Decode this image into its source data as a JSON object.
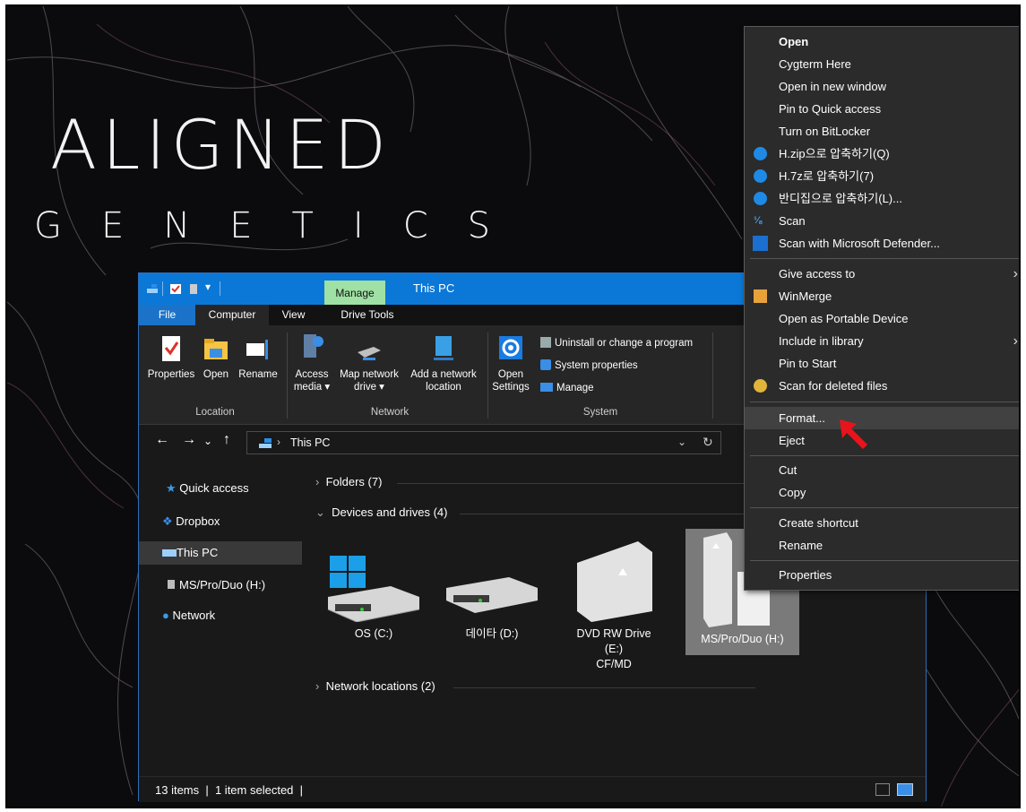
{
  "wallpaper": {
    "logo_main": "ALIGNED",
    "logo_sub": "GENETICS"
  },
  "explorer": {
    "title": "This PC",
    "context_tab": "Manage",
    "ribbon_tabs": [
      "File",
      "Computer",
      "View",
      "Drive Tools"
    ],
    "ribbon": {
      "location": {
        "group": "Location",
        "properties": "Properties",
        "open": "Open",
        "rename": "Rename"
      },
      "network": {
        "group": "Network",
        "access_media_1": "Access",
        "access_media_2": "media",
        "map_drive_1": "Map network",
        "map_drive_2": "drive",
        "add_location_1": "Add a network",
        "add_location_2": "location"
      },
      "system": {
        "group": "System",
        "open_settings_1": "Open",
        "open_settings_2": "Settings",
        "uninstall": "Uninstall or change a program",
        "system_properties": "System properties",
        "manage": "Manage"
      }
    },
    "address": {
      "path": "This PC"
    },
    "nav": {
      "quick_access": "Quick access",
      "dropbox": "Dropbox",
      "this_pc": "This PC",
      "ms_drive": "MS/Pro/Duo (H:)",
      "network": "Network"
    },
    "groups": {
      "folders": "Folders (7)",
      "devices": "Devices and drives (4)",
      "network_locations": "Network locations (2)"
    },
    "drives": [
      {
        "label": "OS (C:)"
      },
      {
        "label": "데이타 (D:)"
      },
      {
        "label_1": "DVD RW Drive (E:)",
        "label_2": "CF/MD"
      },
      {
        "label": "MS/Pro/Duo (H:)"
      }
    ],
    "status": {
      "items": "13 items",
      "selected": "1 item selected"
    }
  },
  "context_menu": {
    "items": [
      {
        "label": "Open",
        "bold": true
      },
      {
        "label": "Cygterm Here"
      },
      {
        "label": "Open in new window"
      },
      {
        "label": "Pin to Quick access"
      },
      {
        "label": "Turn on BitLocker"
      },
      {
        "label": "H.zip으로 압축하기(Q)",
        "icon": "bandizip-icon"
      },
      {
        "label": "H.7z로 압축하기(7)",
        "icon": "bandizip-icon"
      },
      {
        "label": "반디집으로 압축하기(L)...",
        "icon": "bandizip-icon"
      },
      {
        "label": "Scan",
        "icon": "scan-icon"
      },
      {
        "label": "Scan with Microsoft Defender...",
        "icon": "defender-shield-icon"
      },
      {
        "label": "Give access to",
        "submenu": true
      },
      {
        "label": "WinMerge",
        "icon": "winmerge-icon"
      },
      {
        "label": "Open as Portable Device"
      },
      {
        "label": "Include in library",
        "submenu": true
      },
      {
        "label": "Pin to Start"
      },
      {
        "label": "Scan for deleted files",
        "icon": "recovery-icon"
      },
      {
        "label": "Format...",
        "highlighted": true
      },
      {
        "label": "Eject"
      },
      {
        "label": "Cut"
      },
      {
        "label": "Copy"
      },
      {
        "label": "Create shortcut"
      },
      {
        "label": "Rename"
      },
      {
        "label": "Properties"
      }
    ]
  },
  "colors": {
    "accent": "#0b78d7",
    "manage_tab": "#9fe0a4",
    "menu_bg": "#2b2b2b",
    "arrow": "#e8141b"
  }
}
